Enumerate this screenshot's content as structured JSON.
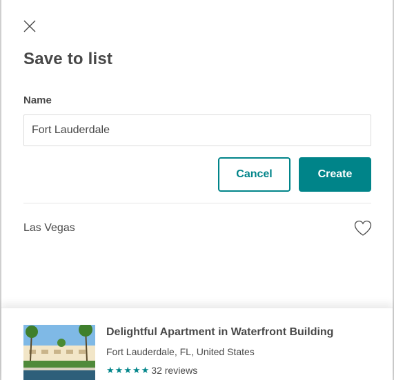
{
  "modal": {
    "title": "Save to list",
    "name_label": "Name",
    "name_value": "Fort Lauderdale",
    "cancel_label": "Cancel",
    "create_label": "Create"
  },
  "lists": [
    {
      "label": "Las Vegas",
      "icon": "heart-outline-icon"
    }
  ],
  "listing": {
    "title": "Delightful Apartment in Waterfront Building",
    "location": "Fort Lauderdale, FL, United States",
    "rating_stars": 5,
    "reviews": "32 reviews"
  },
  "colors": {
    "accent": "#008489",
    "text": "#484848",
    "border": "#dbdbdb"
  }
}
